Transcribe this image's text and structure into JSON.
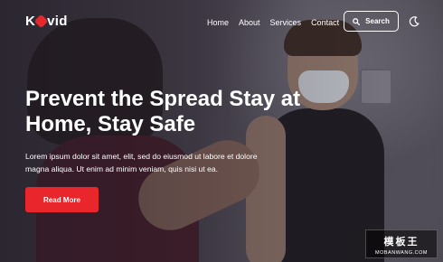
{
  "brand": {
    "prefix": "K",
    "suffix": "vid",
    "accent": "#e8262c"
  },
  "nav": {
    "items": [
      {
        "label": "Home"
      },
      {
        "label": "About"
      },
      {
        "label": "Services"
      },
      {
        "label": "Contact"
      }
    ],
    "search_label": "Search"
  },
  "hero": {
    "headline": "Prevent the Spread Stay at Home, Stay Safe",
    "paragraph": "Lorem ipsum dolor sit amet, elit, sed do eiusmod ut labore et dolore magna aliqua. Ut enim ad minim veniam, quis nisi ut ea.",
    "cta_label": "Read More"
  },
  "watermark": {
    "line1": "模板王",
    "line2": "MOBANWANG.COM"
  },
  "icons": [
    "virus-icon",
    "search-icon",
    "moon-icon"
  ]
}
